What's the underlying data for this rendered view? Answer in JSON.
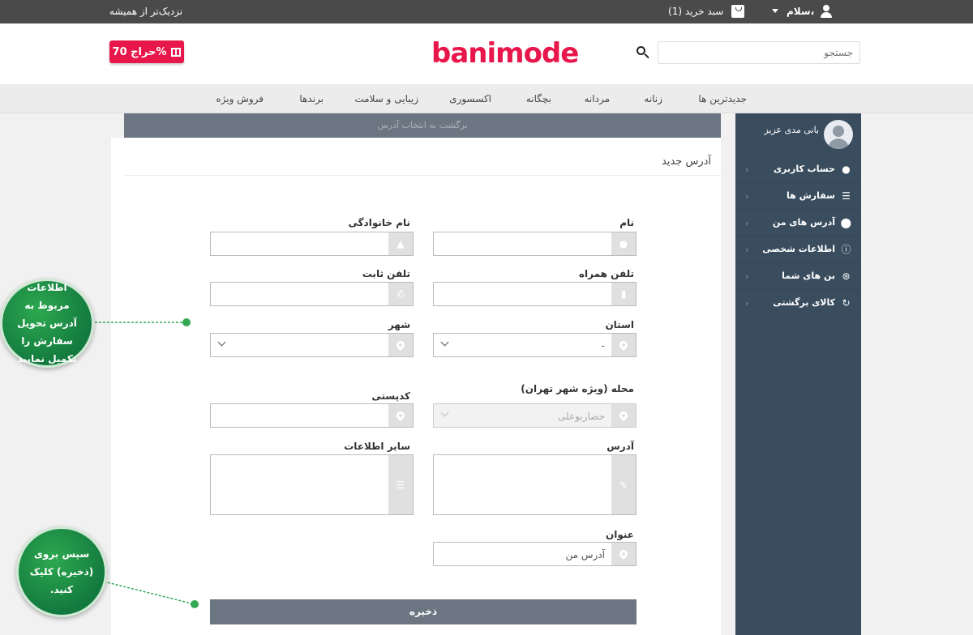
{
  "topbar": {
    "tagline": "نزدیک‌تر از همیشه",
    "cart": "سبد خرید (1)",
    "hello": "سلام،"
  },
  "header": {
    "sale": "حراج 70%",
    "logo": "banimode",
    "search_placeholder": "جستجو"
  },
  "nav": [
    "جدیدترین ها",
    "زنانه",
    "مردانه",
    "بچگانه",
    "اکسسوری",
    "زیبایی و سلامت",
    "برندها",
    "فروش ویژه"
  ],
  "back": "برگشت به انتخاب آدرس",
  "form": {
    "title": "آدرس جدید",
    "name_label": "نام",
    "family_label": "نام خانوادگی",
    "mobile_label": "تلفن همراه",
    "phone_label": "تلفن ثابت",
    "province_label": "استان",
    "province_value": "-",
    "city_label": "شهر",
    "district_label": "محله (ویژه شهر تهران)",
    "district_value": "حصاربوعلی",
    "postal_label": "کدپستی",
    "address_label": "آدرس",
    "other_label": "سایر اطلاعات",
    "alias_label": "عنوان",
    "alias_value": "آدرس من",
    "save": "ذخیره"
  },
  "sidebar": {
    "user": "بانی مدی عزیز",
    "items": [
      "حساب کاربری",
      "سفارش ها",
      "آدرس های من",
      "اطلاعات شخصی",
      "بن های شما",
      "کالای برگشتی"
    ]
  },
  "callouts": {
    "one": "اطلاعات مربوط به آدرس تحویل سفارش را تکمیل نمایید",
    "two": "سپس بروی (ذخیره) کلیک کنید."
  },
  "colors": {
    "accent": "#e8174b",
    "sidebar": "#3a4d5f",
    "button": "#6b7682",
    "callout": "#1f8f45"
  }
}
